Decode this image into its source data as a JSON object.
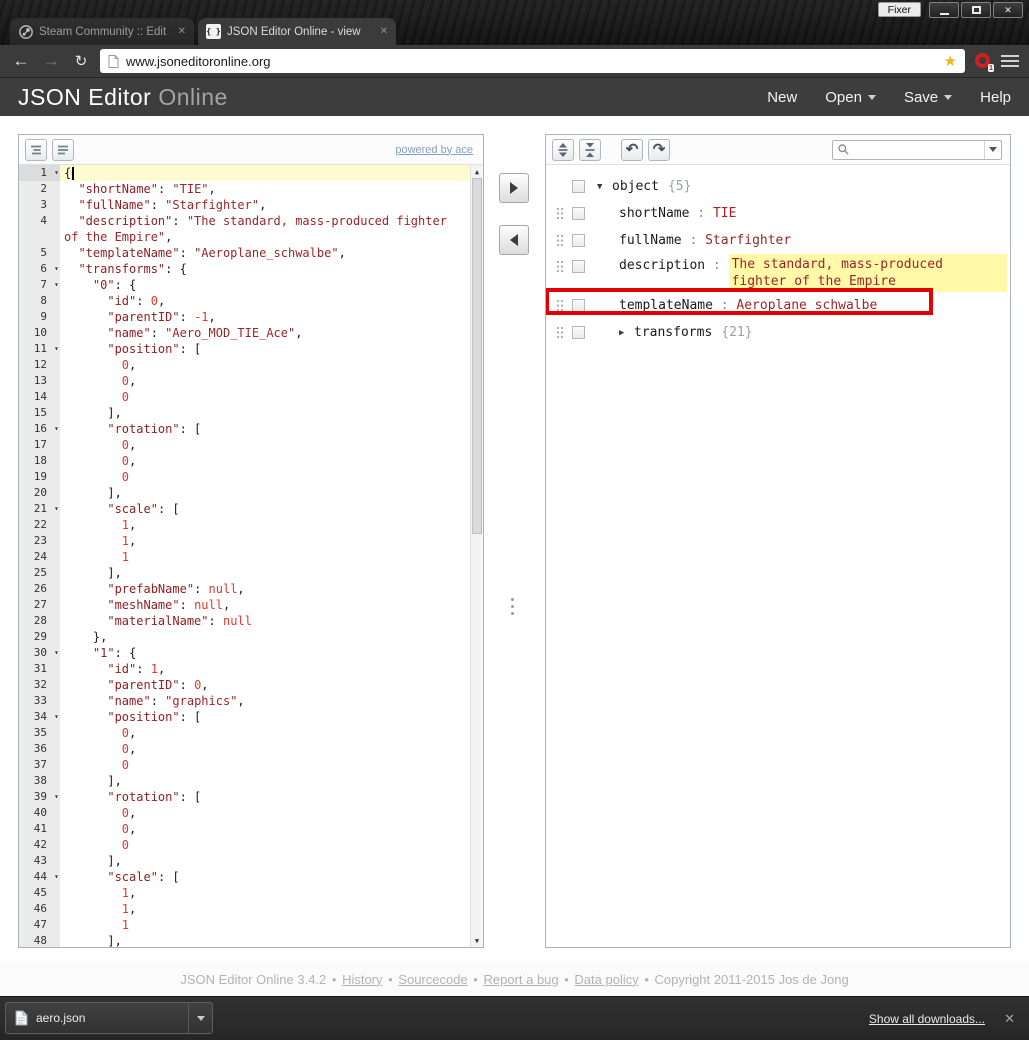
{
  "window": {
    "fixer_label": "Fixer"
  },
  "browser": {
    "tabs": [
      {
        "title": "Steam Community :: Edit",
        "icon": "steam-icon",
        "active": false
      },
      {
        "title": "JSON Editor Online - view",
        "icon": "json-braces-icon",
        "active": true
      }
    ],
    "url": "www.jsoneditoronline.org",
    "downloads_shelf": {
      "file_name": "aero.json",
      "show_all_label": "Show all downloads...",
      "close_icon": "close-icon"
    }
  },
  "site": {
    "brand_primary": "JSON Editor",
    "brand_secondary": "Online",
    "menu": [
      {
        "label": "New",
        "dropdown": false
      },
      {
        "label": "Open",
        "dropdown": true
      },
      {
        "label": "Save",
        "dropdown": true
      },
      {
        "label": "Help",
        "dropdown": false
      }
    ]
  },
  "code_editor": {
    "powered_by": "powered by ace",
    "rows": [
      {
        "n": "1",
        "t": "{",
        "fold": true,
        "active": true
      },
      {
        "n": "2",
        "t": "  \"shortName\": \"TIE\","
      },
      {
        "n": "3",
        "t": "  \"fullName\": \"Starfighter\","
      },
      {
        "n": "4",
        "t": "  \"description\": \"The standard, mass-produced fighter",
        "strOpen": true
      },
      {
        "n": "",
        "t": "of the Empire\",",
        "strCont": true
      },
      {
        "n": "5",
        "t": "  \"templateName\": \"Aeroplane_schwalbe\","
      },
      {
        "n": "6",
        "t": "  \"transforms\": {",
        "fold": true
      },
      {
        "n": "7",
        "t": "    \"0\": {",
        "fold": true
      },
      {
        "n": "8",
        "t": "      \"id\": 0,"
      },
      {
        "n": "9",
        "t": "      \"parentID\": -1,"
      },
      {
        "n": "10",
        "t": "      \"name\": \"Aero_MOD_TIE_Ace\","
      },
      {
        "n": "11",
        "t": "      \"position\": [",
        "fold": true
      },
      {
        "n": "12",
        "t": "        0,"
      },
      {
        "n": "13",
        "t": "        0,"
      },
      {
        "n": "14",
        "t": "        0"
      },
      {
        "n": "15",
        "t": "      ],"
      },
      {
        "n": "16",
        "t": "      \"rotation\": [",
        "fold": true
      },
      {
        "n": "17",
        "t": "        0,"
      },
      {
        "n": "18",
        "t": "        0,"
      },
      {
        "n": "19",
        "t": "        0"
      },
      {
        "n": "20",
        "t": "      ],"
      },
      {
        "n": "21",
        "t": "      \"scale\": [",
        "fold": true
      },
      {
        "n": "22",
        "t": "        1,"
      },
      {
        "n": "23",
        "t": "        1,"
      },
      {
        "n": "24",
        "t": "        1"
      },
      {
        "n": "25",
        "t": "      ],"
      },
      {
        "n": "26",
        "t": "      \"prefabName\": null,"
      },
      {
        "n": "27",
        "t": "      \"meshName\": null,"
      },
      {
        "n": "28",
        "t": "      \"materialName\": null"
      },
      {
        "n": "29",
        "t": "    },"
      },
      {
        "n": "30",
        "t": "    \"1\": {",
        "fold": true
      },
      {
        "n": "31",
        "t": "      \"id\": 1,"
      },
      {
        "n": "32",
        "t": "      \"parentID\": 0,"
      },
      {
        "n": "33",
        "t": "      \"name\": \"graphics\","
      },
      {
        "n": "34",
        "t": "      \"position\": [",
        "fold": true
      },
      {
        "n": "35",
        "t": "        0,"
      },
      {
        "n": "36",
        "t": "        0,"
      },
      {
        "n": "37",
        "t": "        0"
      },
      {
        "n": "38",
        "t": "      ],"
      },
      {
        "n": "39",
        "t": "      \"rotation\": [",
        "fold": true
      },
      {
        "n": "40",
        "t": "        0,"
      },
      {
        "n": "41",
        "t": "        0,"
      },
      {
        "n": "42",
        "t": "        0"
      },
      {
        "n": "43",
        "t": "      ],"
      },
      {
        "n": "44",
        "t": "      \"scale\": [",
        "fold": true
      },
      {
        "n": "45",
        "t": "        1,"
      },
      {
        "n": "46",
        "t": "        1,"
      },
      {
        "n": "47",
        "t": "        1"
      },
      {
        "n": "48",
        "t": "      ],"
      }
    ]
  },
  "tree_editor": {
    "search_placeholder": "",
    "rows": [
      {
        "kind": "root",
        "label": "object",
        "count": "{5}"
      },
      {
        "kind": "value",
        "field": "shortName",
        "value": "TIE"
      },
      {
        "kind": "value",
        "field": "fullName",
        "value": "Starfighter"
      },
      {
        "kind": "value",
        "field": "description",
        "value": "The standard, mass-produced fighter of the Empire",
        "highlight": true
      },
      {
        "kind": "value",
        "field": "templateName",
        "value": "Aeroplane_schwalbe",
        "annotated": true
      },
      {
        "kind": "branch",
        "field": "transforms",
        "count": "{21}"
      }
    ]
  },
  "footer": {
    "separator": "•",
    "segments": [
      {
        "text": "JSON Editor Online 3.4.2",
        "link": false
      },
      {
        "text": "History",
        "link": true
      },
      {
        "text": "Sourcecode",
        "link": true
      },
      {
        "text": "Report a bug",
        "link": true
      },
      {
        "text": "Data policy",
        "link": true
      },
      {
        "text": "Copyright 2011-2015 Jos de Jong",
        "link": false
      }
    ]
  },
  "colors": {
    "annotation_red": "#e40000",
    "value_highlight_yellow": "#fff9a8",
    "active_line_yellow": "#FFFBD1",
    "string_color": "#9c2626",
    "number_color": "#e23a2d",
    "star_gold": "#f0b41e",
    "extension_badge_red": "#cf1f1f"
  }
}
